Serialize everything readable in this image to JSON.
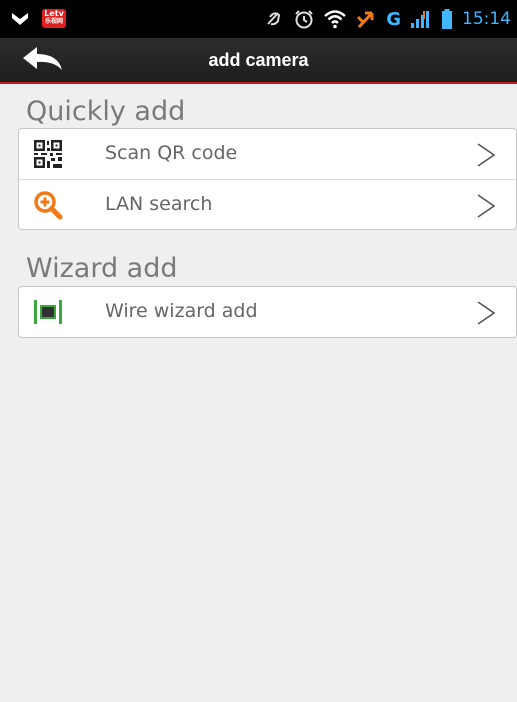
{
  "status_bar": {
    "app_badge_top": "Letv",
    "app_badge_bottom": "乐视网",
    "network_type": "G",
    "time": "15:14"
  },
  "header": {
    "title": "add camera",
    "back_icon": "back-arrow-icon"
  },
  "sections": {
    "quick": {
      "heading": "Quickly add",
      "items": [
        {
          "label": "Scan QR code",
          "icon": "qr-code-icon"
        },
        {
          "label": "LAN search",
          "icon": "magnifier-plus-icon"
        }
      ]
    },
    "wizard": {
      "heading": "Wizard add",
      "items": [
        {
          "label": "Wire wizard add",
          "icon": "wired-camera-icon"
        }
      ]
    }
  },
  "colors": {
    "accent_red": "#c41a1a",
    "status_blue": "#3fb6ff",
    "search_icon_orange": "#f07a18",
    "wizard_icon_green": "#3aa83a"
  }
}
